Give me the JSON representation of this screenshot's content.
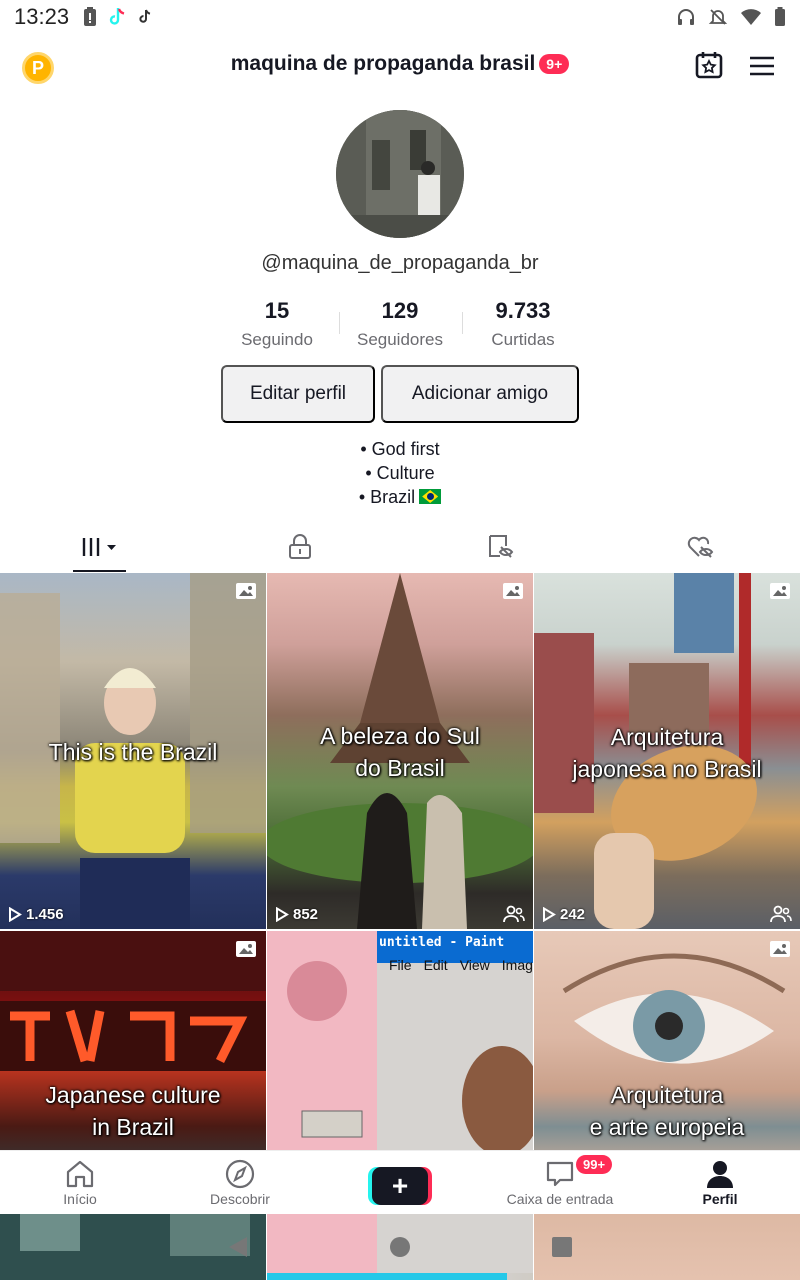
{
  "status_bar": {
    "time": "13:23"
  },
  "header": {
    "title": "maquina de propaganda brasil",
    "notification_badge": "9+",
    "coin_letter": "P"
  },
  "profile": {
    "username": "@maquina_de_propaganda_br",
    "stats": [
      {
        "value": "15",
        "label": "Seguindo"
      },
      {
        "value": "129",
        "label": "Seguidores"
      },
      {
        "value": "9.733",
        "label": "Curtidas"
      }
    ],
    "edit_button": "Editar perfil",
    "add_friend_button": "Adicionar amigo",
    "bio": [
      "• God first",
      "• Culture",
      "• Brazil"
    ]
  },
  "tabs": [
    {
      "icon": "grid-icon",
      "active": true
    },
    {
      "icon": "lock-icon",
      "active": false
    },
    {
      "icon": "repost-icon",
      "active": false
    },
    {
      "icon": "liked-icon",
      "active": false
    }
  ],
  "videos": [
    {
      "caption": [
        "This is the Brazil"
      ],
      "views": "1.456",
      "friends": false
    },
    {
      "caption": [
        "A beleza do Sul",
        "do Brasil"
      ],
      "views": "852",
      "friends": true
    },
    {
      "caption": [
        "Arquitetura",
        "japonesa no Brasil"
      ],
      "views": "242",
      "friends": true
    },
    {
      "caption": [
        "Japanese culture",
        "in Brazil"
      ],
      "views": "",
      "friends": false
    },
    {
      "caption": [],
      "views": "",
      "friends": false,
      "screen_text": "untitled - Paint",
      "menu": [
        "File",
        "Edit",
        "View",
        "Imag"
      ]
    },
    {
      "caption": [
        "Arquitetura",
        "e arte europeia"
      ],
      "views": "",
      "friends": false
    }
  ],
  "bottom_nav": [
    {
      "label": "Início",
      "icon": "home-icon"
    },
    {
      "label": "Descobrir",
      "icon": "compass-icon"
    },
    {
      "label": "",
      "icon": "plus-icon"
    },
    {
      "label": "Caixa de entrada",
      "icon": "inbox-icon",
      "badge": "99+"
    },
    {
      "label": "Perfil",
      "icon": "profile-icon"
    }
  ],
  "colors": {
    "accent": "#fe2c55",
    "cyan": "#25f4ee",
    "text": "#161823",
    "muted": "#6b6b70",
    "button_bg": "#f1f1f2"
  }
}
